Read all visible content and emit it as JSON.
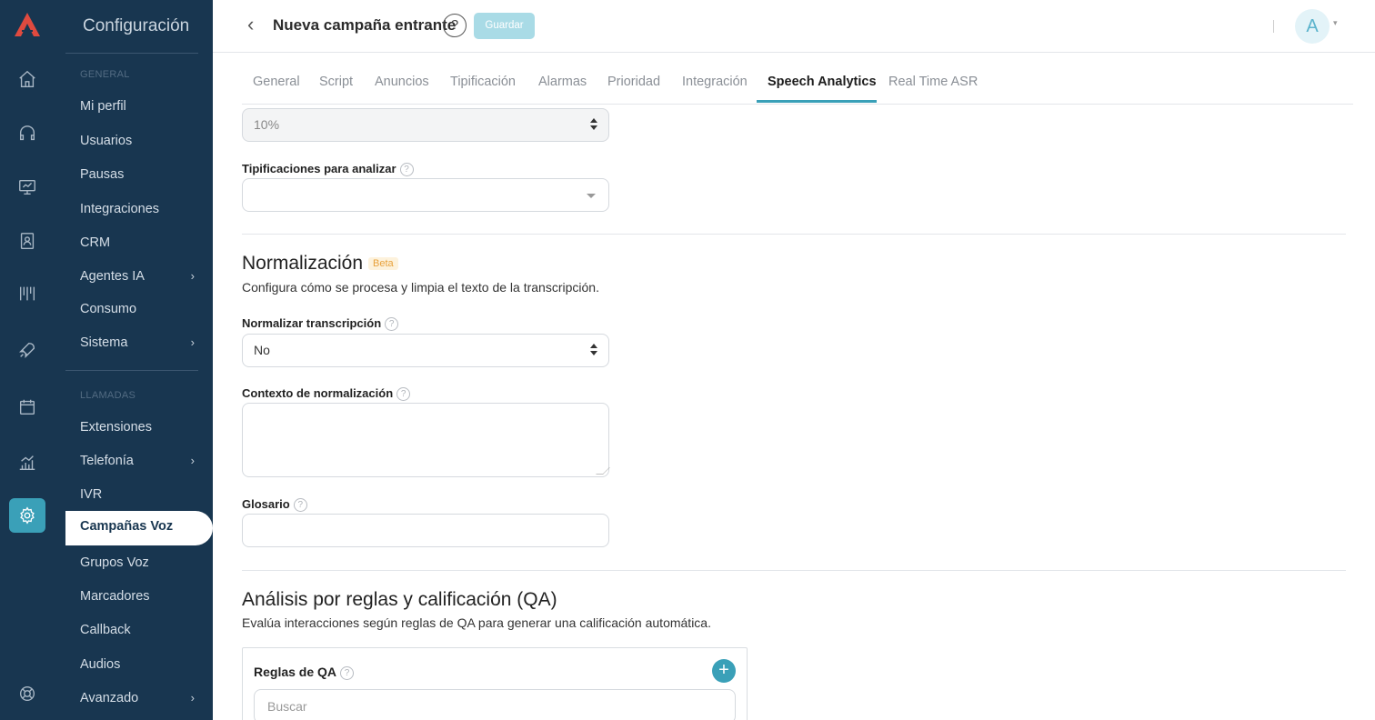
{
  "sidebar": {
    "title": "Configuración",
    "sections": {
      "general": "GENERAL",
      "calls": "LLAMADAS"
    },
    "general_items": [
      {
        "label": "Mi perfil",
        "has_children": false
      },
      {
        "label": "Usuarios",
        "has_children": false
      },
      {
        "label": "Pausas",
        "has_children": false
      },
      {
        "label": "Integraciones",
        "has_children": false
      },
      {
        "label": "CRM",
        "has_children": false
      },
      {
        "label": "Agentes IA",
        "has_children": true
      },
      {
        "label": "Consumo",
        "has_children": false
      },
      {
        "label": "Sistema",
        "has_children": true
      }
    ],
    "call_items": [
      {
        "label": "Extensiones",
        "has_children": false
      },
      {
        "label": "Telefonía",
        "has_children": true
      },
      {
        "label": "IVR",
        "has_children": false
      },
      {
        "label": "Campañas Voz",
        "has_children": false,
        "active": true
      },
      {
        "label": "Grupos Voz",
        "has_children": false
      },
      {
        "label": "Marcadores",
        "has_children": false
      },
      {
        "label": "Callback",
        "has_children": false
      },
      {
        "label": "Audios",
        "has_children": false
      },
      {
        "label": "Avanzado",
        "has_children": true
      }
    ],
    "chevron": "›"
  },
  "rail": {
    "icons": [
      "home-icon",
      "headset-icon",
      "monitor-icon",
      "contacts-icon",
      "kanban-icon",
      "rocket-icon",
      "calendar-icon",
      "reports-icon",
      "settings-icon",
      "lifebuoy-icon"
    ],
    "active": "settings-icon",
    "brand_color": "#e04a3f"
  },
  "header": {
    "back": "‹",
    "title": "Nueva campaña entrante",
    "help": "?",
    "save_label": "Guardar",
    "avatar_initial": "A",
    "avatar_caret": "▾"
  },
  "tabs": {
    "items": [
      "General",
      "Script",
      "Anuncios",
      "Tipificación",
      "Alarmas",
      "Prioridad",
      "Integración",
      "Speech Analytics",
      "Real Time ASR"
    ],
    "active": "Speech Analytics",
    "accent": "#3aa0b8"
  },
  "form": {
    "percentage": {
      "value": "10%"
    },
    "tipificaciones": {
      "label": "Tipificaciones para analizar",
      "value": ""
    },
    "normalization": {
      "title": "Normalización",
      "badge": "Beta",
      "description": "Configura cómo se procesa y limpia el texto de la transcripción.",
      "normalize": {
        "label": "Normalizar transcripción",
        "value": "No"
      },
      "context": {
        "label": "Contexto de normalización",
        "value": ""
      },
      "glossary": {
        "label": "Glosario",
        "value": ""
      }
    },
    "qa": {
      "title": "Análisis por reglas y calificación (QA)",
      "description": "Evalúa interacciones según reglas de QA para generar una calificación automática.",
      "rules_label": "Reglas de QA",
      "add": "+",
      "search_placeholder": "Buscar"
    },
    "help_glyph": "?"
  }
}
